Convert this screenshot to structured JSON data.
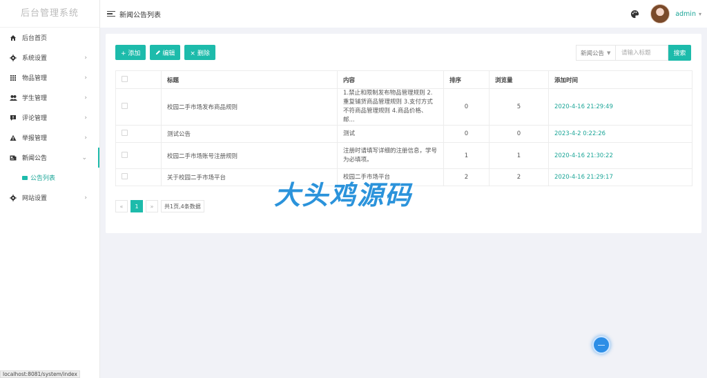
{
  "sidebar": {
    "title": "后台管理系统",
    "items": [
      {
        "label": "后台首页",
        "icon": "home-icon"
      },
      {
        "label": "系统设置",
        "icon": "gear-icon",
        "arrow": "›"
      },
      {
        "label": "物品管理",
        "icon": "grid-icon",
        "arrow": "›"
      },
      {
        "label": "学生管理",
        "icon": "users-icon",
        "arrow": "›"
      },
      {
        "label": "评论管理",
        "icon": "comment-icon",
        "arrow": "›"
      },
      {
        "label": "举报管理",
        "icon": "warning-icon",
        "arrow": "›"
      },
      {
        "label": "新闻公告",
        "icon": "news-icon",
        "arrow": "⌄"
      },
      {
        "label": "网站设置",
        "icon": "gear-icon",
        "arrow": "›"
      }
    ],
    "subitem": {
      "label": "公告列表",
      "icon": "list-icon"
    }
  },
  "header": {
    "page_title": "新闻公告列表",
    "user": "admin",
    "caret": "▾"
  },
  "toolbar": {
    "add": "+ 添加",
    "edit": "编辑",
    "delete": "× 删除"
  },
  "search": {
    "select_value": "新闻公告",
    "placeholder": "请输入标题",
    "button": "搜索"
  },
  "table": {
    "headers": [
      "标题",
      "内容",
      "排序",
      "浏览量",
      "添加时间"
    ],
    "rows": [
      {
        "title": "校园二手市场发布商品规则",
        "content": "1.禁止和限制发布物品管理规则 2.重复铺货商品管理规则 3.支付方式不符商品管理规则 4.商品价格、邮...",
        "sort": "0",
        "views": "5",
        "time": "2020-4-16 21:29:49"
      },
      {
        "title": "测试公告",
        "content": "测试",
        "sort": "0",
        "views": "0",
        "time": "2023-4-2 0:22:26"
      },
      {
        "title": "校园二手市场账号注册规则",
        "content": "注册时请填写详细的注册信息，学号为必填项。",
        "sort": "1",
        "views": "1",
        "time": "2020-4-16 21:30:22"
      },
      {
        "title": "关于校园二手市场平台",
        "content": "校园二手市场平台",
        "sort": "2",
        "views": "2",
        "time": "2020-4-16 21:29:17"
      }
    ]
  },
  "pager": {
    "prev": "«",
    "page": "1",
    "next": "»",
    "info": "共1页,4条数据"
  },
  "watermark": "大头鸡源码",
  "statusbar": "localhost:8081/system/index",
  "colors": {
    "accent": "#1dbbab",
    "time_text": "#1aa597"
  }
}
